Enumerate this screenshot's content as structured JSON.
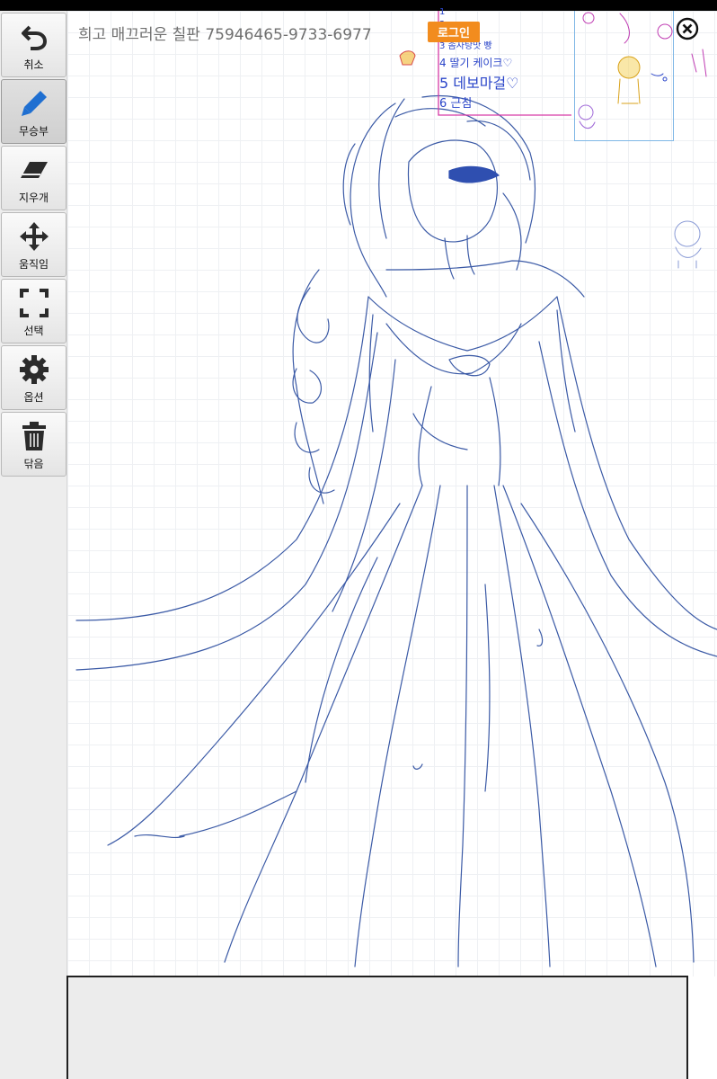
{
  "toolbar": {
    "tools": [
      {
        "label": "취소",
        "icon": "undo-icon",
        "active": false
      },
      {
        "label": "무승부",
        "icon": "pencil-icon",
        "active": true
      },
      {
        "label": "지우개",
        "icon": "eraser-icon",
        "active": false
      },
      {
        "label": "움직임",
        "icon": "move-icon",
        "active": false
      },
      {
        "label": "선택",
        "icon": "select-icon",
        "active": false
      },
      {
        "label": "옵션",
        "icon": "gear-icon",
        "active": false
      },
      {
        "label": "닦음",
        "icon": "trash-icon",
        "active": false
      }
    ]
  },
  "header": {
    "title": "희고 매끄러운 칠판 75946465-9733-6977",
    "login_label": "로그인",
    "close_icon": "close-icon"
  },
  "canvas_note": {
    "lines": [
      "1",
      "2",
      "3 솜사탕맛 빵",
      "4 딸기 케이크♡",
      "5 데보마걸♡",
      "6 근침"
    ]
  },
  "colors": {
    "accent": "#f28c1e",
    "pen_ink": "#3b5aa6",
    "note_ink": "#2a45c9",
    "note_frame": "#d63aa6",
    "mini_frame": "#7fb7e6",
    "active_tool_icon": "#1f6fd1"
  }
}
